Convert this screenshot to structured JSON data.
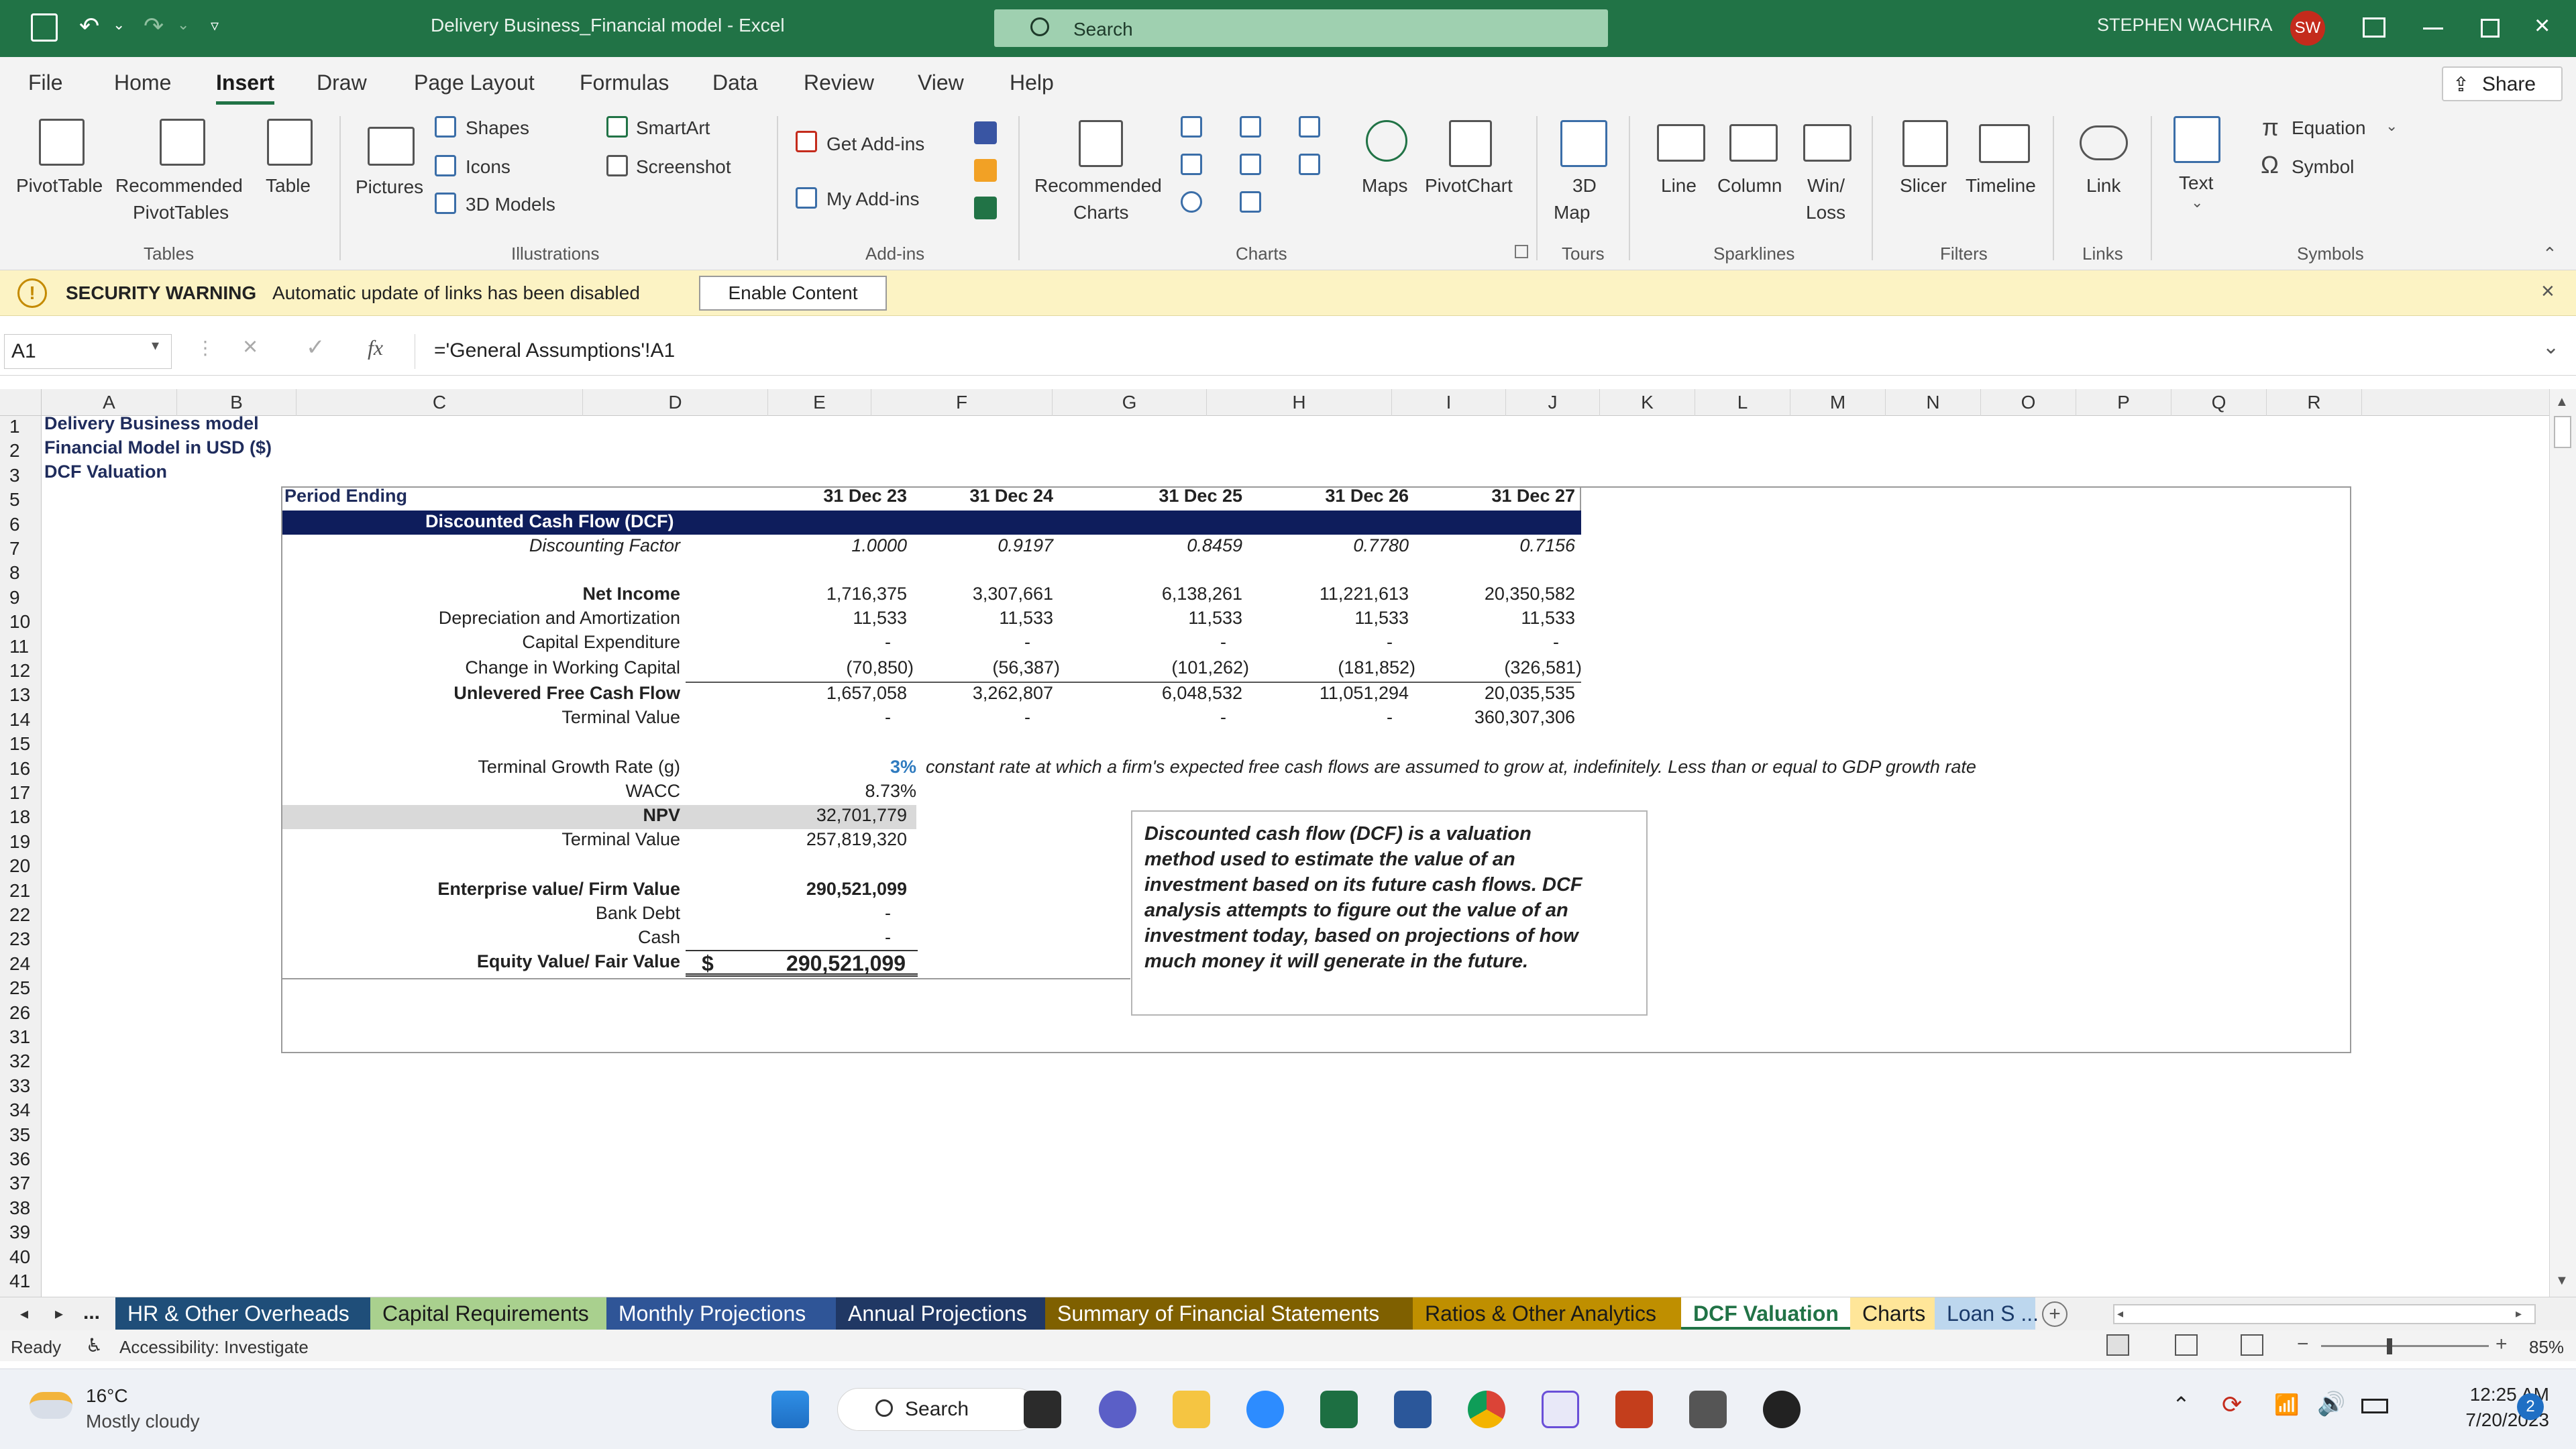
{
  "titlebar": {
    "doc_title": "Delivery Business_Financial model  -  Excel",
    "search_placeholder": "Search",
    "user_name": "STEPHEN WACHIRA",
    "user_initials": "SW"
  },
  "menu": [
    "File",
    "Home",
    "Insert",
    "Draw",
    "Page Layout",
    "Formulas",
    "Data",
    "Review",
    "View",
    "Help"
  ],
  "active_menu": "Insert",
  "share_label": "Share",
  "ribbon": {
    "pivottable": "PivotTable",
    "recommended_pivottables_1": "Recommended",
    "recommended_pivottables_2": "PivotTables",
    "table": "Table",
    "pictures": "Pictures",
    "shapes": "Shapes",
    "icons": "Icons",
    "models3d": "3D Models",
    "smartart": "SmartArt",
    "screenshot": "Screenshot",
    "get_addins": "Get Add-ins",
    "my_addins": "My Add-ins",
    "recommended_charts_1": "Recommended",
    "recommended_charts_2": "Charts",
    "maps": "Maps",
    "pivotchart": "PivotChart",
    "map3d_1": "3D",
    "map3d_2": "Map",
    "line": "Line",
    "column": "Column",
    "winloss_1": "Win/",
    "winloss_2": "Loss",
    "slicer": "Slicer",
    "timeline": "Timeline",
    "link": "Link",
    "text": "Text",
    "equation": "Equation",
    "symbol": "Symbol",
    "groups": {
      "tables": "Tables",
      "illustrations": "Illustrations",
      "addins": "Add-ins",
      "charts": "Charts",
      "tours": "Tours",
      "sparklines": "Sparklines",
      "filters": "Filters",
      "links": "Links",
      "symbols": "Symbols"
    }
  },
  "security": {
    "title": "SECURITY WARNING",
    "message": "Automatic update of links has been disabled",
    "button": "Enable Content"
  },
  "formula": {
    "cell_ref": "A1",
    "fx": "fx",
    "value": "='General Assumptions'!A1"
  },
  "columns": [
    "A",
    "B",
    "C",
    "D",
    "E",
    "F",
    "G",
    "H",
    "I",
    "J",
    "K",
    "L",
    "M",
    "N",
    "O",
    "P",
    "Q",
    "R"
  ],
  "rows": [
    "1",
    "2",
    "3",
    "5",
    "6",
    "7",
    "8",
    "9",
    "10",
    "11",
    "12",
    "13",
    "14",
    "15",
    "16",
    "17",
    "18",
    "19",
    "20",
    "21",
    "22",
    "23",
    "24",
    "25",
    "26",
    "31",
    "32",
    "33",
    "34",
    "35",
    "36",
    "37",
    "38",
    "39",
    "40",
    "41"
  ],
  "sheet": {
    "a1": "Delivery Business model",
    "a2": "Financial  Model in USD ($)",
    "a3": "DCF Valuation",
    "period_ending": "Period Ending",
    "dates": [
      "31 Dec 23",
      "31 Dec 24",
      "31 Dec 25",
      "31 Dec 26",
      "31 Dec 27"
    ],
    "dcf_header": "Discounted Cash Flow (DCF)",
    "discounting_factor_label": "Discounting Factor",
    "discounting_factor": [
      "1.0000",
      "0.9197",
      "0.8459",
      "0.7780",
      "0.7156"
    ],
    "net_income_label": "Net Income",
    "net_income": [
      "1,716,375",
      "3,307,661",
      "6,138,261",
      "11,221,613",
      "20,350,582"
    ],
    "da_label": "Depreciation and Amortization",
    "da": [
      "11,533",
      "11,533",
      "11,533",
      "11,533",
      "11,533"
    ],
    "capex_label": "Capital Expenditure",
    "capex": [
      "-",
      "-",
      "-",
      "-",
      "-"
    ],
    "wc_label": "Change in Working Capital",
    "wc": [
      "(70,850)",
      "(56,387)",
      "(101,262)",
      "(181,852)",
      "(326,581)"
    ],
    "ufcf_label": "Unlevered Free Cash Flow",
    "ufcf": [
      "1,657,058",
      "3,262,807",
      "6,048,532",
      "11,051,294",
      "20,035,535"
    ],
    "tv_label": "Terminal Value",
    "tv": [
      "-",
      "-",
      "-",
      "-",
      "360,307,306"
    ],
    "tgr_label": "Terminal Growth Rate (g)",
    "tgr": "3%",
    "tgr_note": "constant rate at which a firm's expected free cash flows are assumed to grow at, indefinitely. Less than or equal to GDP growth rate",
    "wacc_label": "WACC",
    "wacc": "8.73%",
    "npv_label": "NPV",
    "npv": "32,701,779",
    "tv2_label": "Terminal Value",
    "tv2": "257,819,320",
    "ev_label": "Enterprise value/ Firm Value",
    "ev": "290,521,099",
    "debt_label": "Bank Debt",
    "debt": "-",
    "cash_label": "Cash",
    "cash": "-",
    "equity_label": "Equity Value/ Fair Value",
    "equity_currency": "$",
    "equity": "290,521,099",
    "textbox_lines": [
      "Discounted cash flow (DCF) is a valuation",
      "method used to estimate the value of an",
      "investment based on its future cash flows. DCF",
      "analysis attempts to figure out the value of an",
      "investment today, based on projections of how",
      "much money it will generate in the future."
    ]
  },
  "sheet_tabs": [
    {
      "label": "HR & Other Overheads",
      "color": "#1f4e79"
    },
    {
      "label": "Capital Requirements",
      "color": "#a9d08e"
    },
    {
      "label": "Monthly Projections",
      "color": "#2f5597"
    },
    {
      "label": "Annual Projections",
      "color": "#203864"
    },
    {
      "label": "Summary of Financial Statements",
      "color": "#7f6000"
    },
    {
      "label": "Ratios & Other Analytics",
      "color": "#bf8f00"
    },
    {
      "label": "DCF Valuation",
      "color": "#ffffff"
    },
    {
      "label": "Charts",
      "color": "#ffe699"
    },
    {
      "label": "Loan S ...",
      "color": "#bdd7ee"
    }
  ],
  "tabs_ellipsis": "...",
  "status": {
    "ready": "Ready",
    "accessibility": "Accessibility: Investigate",
    "zoom": "85%"
  },
  "taskbar": {
    "temp": "16°C",
    "weather": "Mostly cloudy",
    "search": "Search",
    "time": "12:25 AM",
    "date": "7/20/2023",
    "notif": "2"
  }
}
